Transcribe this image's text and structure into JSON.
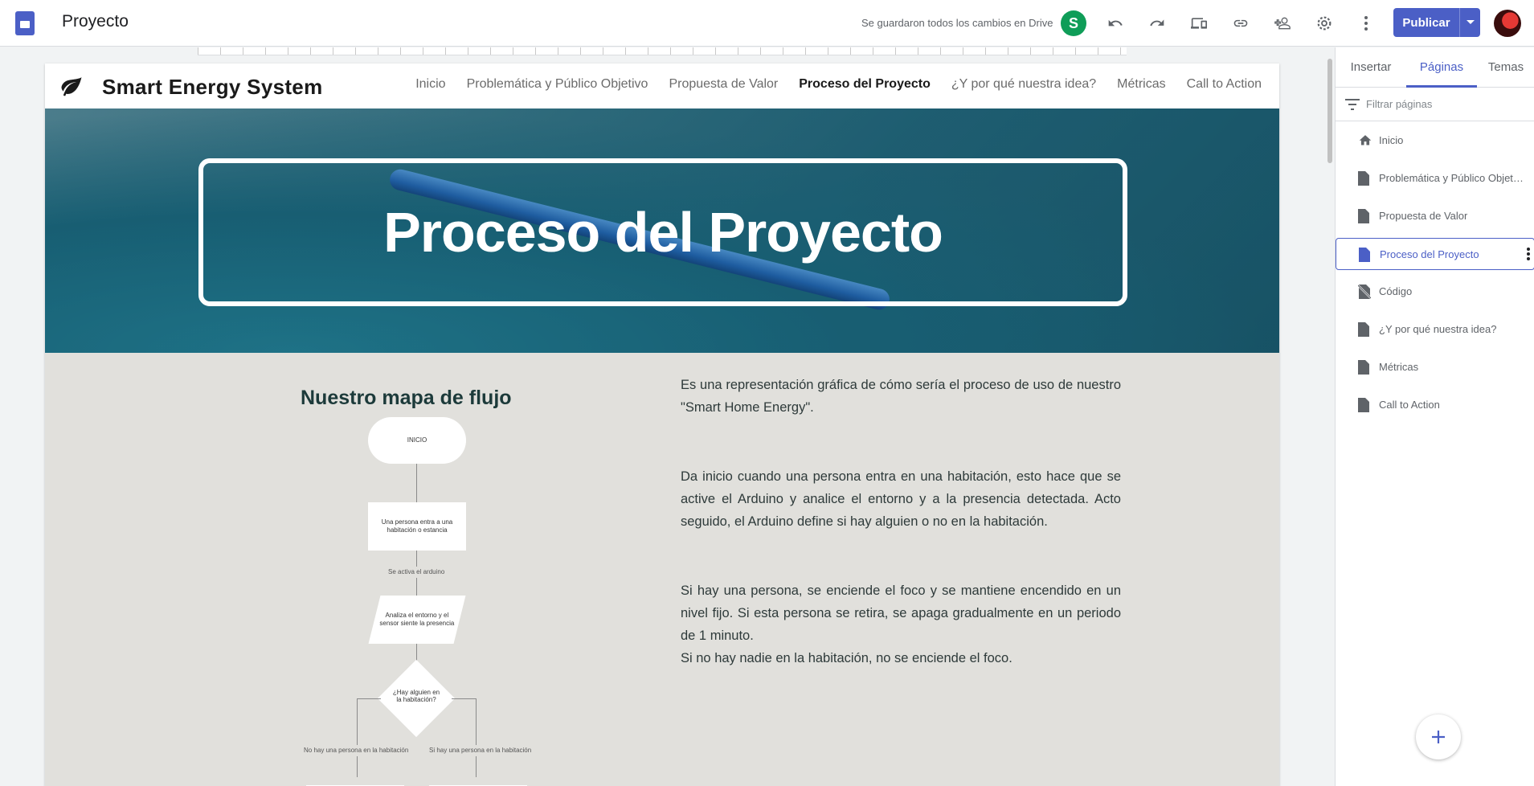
{
  "app": {
    "doc_title": "Proyecto",
    "save_status": "Se guardaron todos los cambios en Drive",
    "user_initial": "S",
    "publish_label": "Publicar",
    "accent_color": "#4b5fc6",
    "toolbar_icons": [
      "undo-icon",
      "redo-icon",
      "preview-icon",
      "link-icon",
      "share-icon",
      "settings-icon",
      "more-icon"
    ]
  },
  "site": {
    "name": "Smart Energy System",
    "nav": [
      {
        "label": "Inicio",
        "active": false
      },
      {
        "label": "Problemática y Público Objetivo",
        "active": false
      },
      {
        "label": "Propuesta de Valor",
        "active": false
      },
      {
        "label": "Proceso del Proyecto",
        "active": true
      },
      {
        "label": "¿Y por qué nuestra idea?",
        "active": false
      },
      {
        "label": "Métricas",
        "active": false
      },
      {
        "label": "Call to Action",
        "active": false
      }
    ],
    "hero_title": "Proceso del Proyecto",
    "flow_title": "Nuestro mapa de flujo",
    "flowchart": {
      "start": "INICIO",
      "step1": "Una persona entra a una habitación o estancia",
      "edge1": "Se activa el arduino",
      "step2": "Analiza el entorno y el sensor siente la presencia",
      "decision": "¿Hay alguien en la habitación?",
      "no_branch": "No hay una persona en la habitación",
      "yes_branch": "Si hay una persona en la habitación"
    },
    "paragraphs": [
      "Es una representación gráfica de cómo sería el proceso de uso de nuestro \"Smart Home Energy\".",
      "Da inicio cuando una persona entra en una habitación, esto hace que se active el Arduino y analice el entorno y a la presencia detectada. Acto seguido, el Arduino define si hay alguien o no en la habitación.",
      "Si  hay una persona, se enciende el foco y se mantiene encendido en un nivel fijo. Si esta persona se retira, se apaga gradualmente en un periodo de 1 minuto.",
      "Si no hay nadie en la habitación, no se enciende el foco."
    ]
  },
  "panel": {
    "tabs": [
      {
        "label": "Insertar",
        "active": false
      },
      {
        "label": "Páginas",
        "active": true
      },
      {
        "label": "Temas",
        "active": false
      }
    ],
    "filter_placeholder": "Filtrar páginas",
    "pages": [
      {
        "label": "Inicio",
        "icon": "home-icon",
        "active": false
      },
      {
        "label": "Problemática y Público Objetivo",
        "icon": "page-icon",
        "active": false
      },
      {
        "label": "Propuesta de Valor",
        "icon": "page-icon",
        "active": false
      },
      {
        "label": "Proceso del Proyecto",
        "icon": "page-icon",
        "active": true
      },
      {
        "label": "Código",
        "icon": "hidden-page-icon",
        "active": false
      },
      {
        "label": "¿Y por qué nuestra idea?",
        "icon": "page-icon",
        "active": false
      },
      {
        "label": "Métricas",
        "icon": "page-icon",
        "active": false
      },
      {
        "label": "Call to Action",
        "icon": "page-icon",
        "active": false
      }
    ]
  }
}
